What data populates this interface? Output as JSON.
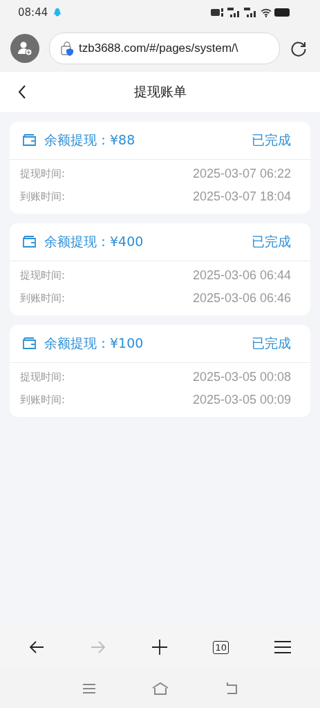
{
  "status_bar": {
    "time": "08:44"
  },
  "browser": {
    "url": "tzb3688.com/#/pages/system/\\",
    "tab_count": "10",
    "forward_disabled": true
  },
  "header": {
    "title": "提现账单"
  },
  "records": [
    {
      "title": "余额提现：¥88",
      "status": "已完成",
      "rows": [
        {
          "label": "提现时间:",
          "value": "2025-03-07 06:22"
        },
        {
          "label": "到账时间:",
          "value": "2025-03-07 18:04"
        }
      ]
    },
    {
      "title": "余额提现：¥400",
      "status": "已完成",
      "rows": [
        {
          "label": "提现时间:",
          "value": "2025-03-06 06:44"
        },
        {
          "label": "到账时间:",
          "value": "2025-03-06 06:46"
        }
      ]
    },
    {
      "title": "余额提现：¥100",
      "status": "已完成",
      "rows": [
        {
          "label": "提现时间:",
          "value": "2025-03-05 00:08"
        },
        {
          "label": "到账时间:",
          "value": "2025-03-05 00:09"
        }
      ]
    }
  ]
}
